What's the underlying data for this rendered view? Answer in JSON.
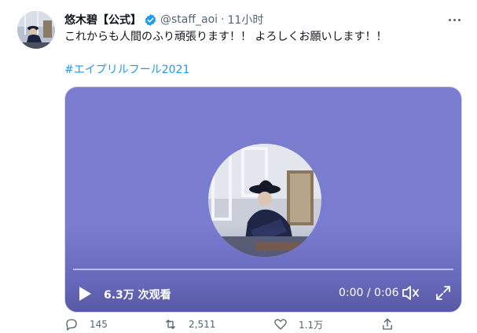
{
  "tweet": {
    "display_name": "悠木碧【公式】",
    "handle": "@staff_aoi",
    "separator": "·",
    "time": "11小时",
    "text": "これからも人間のふり頑張ります！！ よろしくお願いします！！",
    "hashtag": "#エイプリルフール2021"
  },
  "video": {
    "views": "6.3万 次观看",
    "timestamp": "0:00 / 0:06",
    "progress": 0
  },
  "actions": {
    "reply_count": "145",
    "retweet_count": "2,511",
    "like_count": "1.1万"
  },
  "colors": {
    "hashtag": "#1d9bf0",
    "verified": "#1d9bf0",
    "media_bg": "#7a7cd0"
  },
  "icons": {
    "verified": "verified-badge-icon",
    "more": "more-icon",
    "play": "play-icon",
    "mute": "volume-muted-icon",
    "fullscreen": "fullscreen-icon",
    "reply": "reply-icon",
    "retweet": "retweet-icon",
    "like": "heart-icon",
    "share": "share-icon"
  }
}
